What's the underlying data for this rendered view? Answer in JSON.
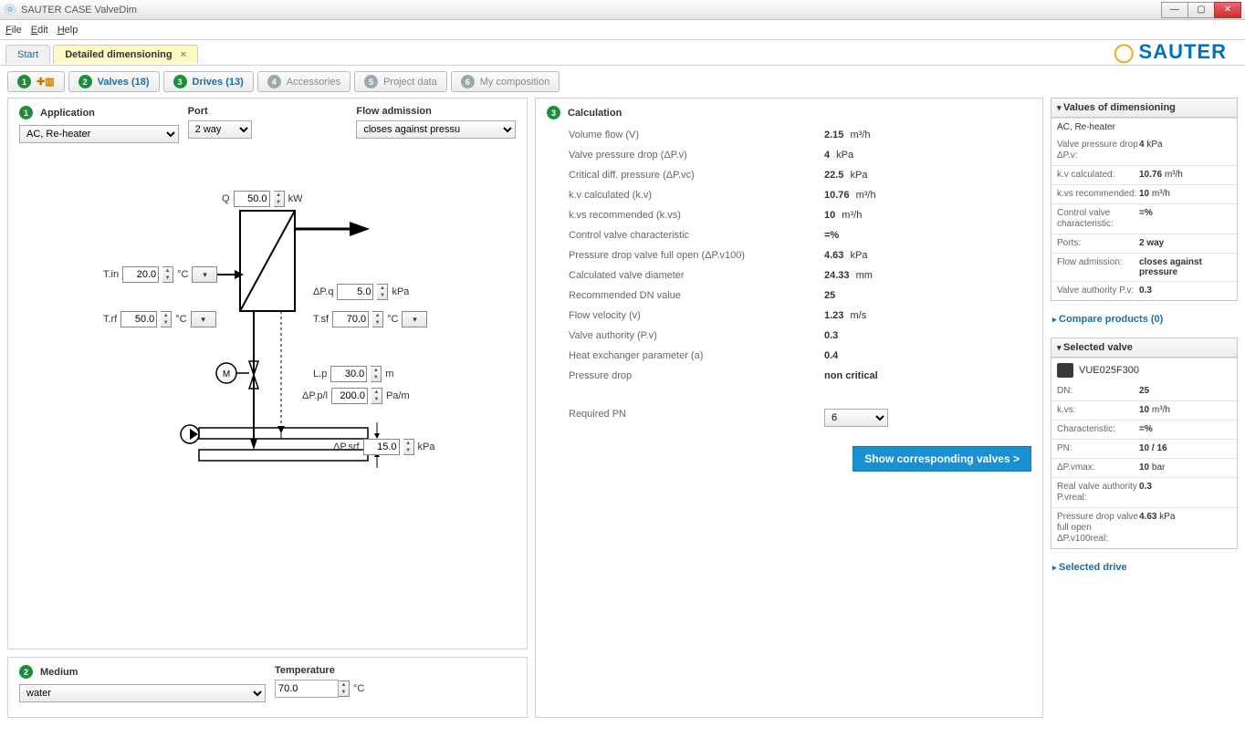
{
  "window": {
    "title": "SAUTER CASE ValveDim"
  },
  "menu": {
    "file": "File",
    "edit": "Edit",
    "help": "Help"
  },
  "brand": "SAUTER",
  "docTabs": {
    "start": "Start",
    "detail": "Detailed dimensioning"
  },
  "steps": {
    "s1": "",
    "s2": "Valves  (18)",
    "s3": "Drives  (13)",
    "s4": "Accessories",
    "s5": "Project data",
    "s6": "My composition"
  },
  "app": {
    "application_lbl": "Application",
    "application_val": "AC, Re-heater",
    "port_lbl": "Port",
    "port_val": "2 way",
    "flow_lbl": "Flow admission",
    "flow_val": "closes against pressu"
  },
  "dg": {
    "Q_lbl": "Q",
    "Q": "50.0",
    "Q_u": "kW",
    "Tin_lbl": "T.in",
    "Tin": "20.0",
    "Tin_u": "°C",
    "Trf_lbl": "T.rf",
    "Trf": "50.0",
    "Trf_u": "°C",
    "dPq_lbl": "ΔP.q",
    "dPq": "5.0",
    "dPq_u": "kPa",
    "Tsf_lbl": "T.sf",
    "Tsf": "70.0",
    "Tsf_u": "°C",
    "Lp_lbl": "L.p",
    "Lp": "30.0",
    "Lp_u": "m",
    "dPpl_lbl": "ΔP.p/l",
    "dPpl": "200.0",
    "dPpl_u": "Pa/m",
    "dPsrf_lbl": "ΔP.srf",
    "dPsrf": "15.0",
    "dPsrf_u": "kPa"
  },
  "medium": {
    "medium_lbl": "Medium",
    "medium_val": "water",
    "temp_lbl": "Temperature",
    "temp_val": "70.0",
    "temp_u": "°C"
  },
  "calc": {
    "head": "Calculation",
    "rows": [
      {
        "k": "Volume flow (V)",
        "v": "2.15",
        "u": "m³/h"
      },
      {
        "k": "Valve pressure drop (ΔP.v)",
        "v": "4",
        "u": "kPa"
      },
      {
        "k": "Critical diff. pressure (ΔP.vc)",
        "v": "22.5",
        "u": "kPa"
      },
      {
        "k": "k.v calculated (k.v)",
        "v": "10.76",
        "u": "m³/h"
      },
      {
        "k": "k.vs recommended (k.vs)",
        "v": "10",
        "u": "m³/h"
      },
      {
        "k": "Control valve characteristic",
        "v": "=%",
        "u": ""
      },
      {
        "k": "Pressure drop valve full open (ΔP.v100)",
        "v": "4.63",
        "u": "kPa"
      },
      {
        "k": "Calculated valve diameter",
        "v": "24.33",
        "u": "mm"
      },
      {
        "k": "Recommended DN value",
        "v": "25",
        "u": ""
      },
      {
        "k": "Flow velocity (v)",
        "v": "1.23",
        "u": "m/s"
      },
      {
        "k": "Valve authority (P.v)",
        "v": "0.3",
        "u": ""
      },
      {
        "k": "Heat exchanger parameter (a)",
        "v": "0.4",
        "u": ""
      },
      {
        "k": "Pressure drop",
        "v": "non critical",
        "u": ""
      }
    ],
    "pn_lbl": "Required PN",
    "pn_val": "6",
    "button": "Show corresponding valves >"
  },
  "dim": {
    "head": "Values of dimensioning",
    "title": "AC, Re-heater",
    "rows": [
      {
        "k": "Valve pressure drop ΔP.v:",
        "v": "4",
        "u": "kPa"
      },
      {
        "k": "k.v calculated:",
        "v": "10.76",
        "u": "m³/h"
      },
      {
        "k": "k.vs recommended:",
        "v": "10",
        "u": "m³/h"
      },
      {
        "k": "Control valve characteristic:",
        "v": "=%",
        "u": ""
      },
      {
        "k": "Ports:",
        "v": "2 way",
        "u": ""
      },
      {
        "k": "Flow admission:",
        "v": "closes against pressure",
        "u": ""
      },
      {
        "k": "Valve authority P.v:",
        "v": "0.3",
        "u": ""
      }
    ]
  },
  "compare": "Compare products  (0)",
  "selValve": {
    "head": "Selected valve",
    "name": "VUE025F300",
    "rows": [
      {
        "k": "DN:",
        "v": "25",
        "u": ""
      },
      {
        "k": "k.vs:",
        "v": "10",
        "u": "m³/h"
      },
      {
        "k": "Characteristic:",
        "v": "=%",
        "u": ""
      },
      {
        "k": "PN:",
        "v": "10 / 16",
        "u": ""
      },
      {
        "k": "ΔP.vmax:",
        "v": "10",
        "u": "bar"
      },
      {
        "k": "Real valve authority P.vreal:",
        "v": "0.3",
        "u": ""
      },
      {
        "k": "Pressure drop valve full open ΔP.v100real:",
        "v": "4.63",
        "u": "kPa"
      }
    ]
  },
  "selDrive": "Selected drive"
}
